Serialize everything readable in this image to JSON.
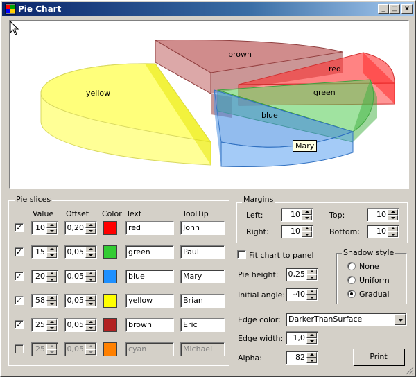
{
  "window": {
    "title": "Pie Chart",
    "minimize_label": "_",
    "maximize_label": "□",
    "close_label": "x"
  },
  "chart_data": {
    "type": "pie",
    "labels": [
      "red",
      "green",
      "blue",
      "yellow",
      "brown"
    ],
    "values": [
      10,
      15,
      20,
      58,
      25
    ],
    "offsets": [
      0.2,
      0.05,
      0.05,
      0.05,
      0.05
    ],
    "colors": [
      "#ff0000",
      "#33cc33",
      "#1e90ff",
      "#ffff00",
      "#b22222"
    ],
    "hidden_slice": {
      "label": "cyan",
      "value": 25
    }
  },
  "tooltip": {
    "text": "Mary"
  },
  "slices_panel": {
    "title": "Pie slices",
    "headers": {
      "value": "Value",
      "offset": "Offset",
      "color": "Color",
      "text": "Text",
      "tooltip": "ToolTip"
    },
    "rows": [
      {
        "checked": "✓",
        "value": "10",
        "offset": "0,20",
        "color": "#ff0000",
        "text": "red",
        "tooltip": "John",
        "enabled": true
      },
      {
        "checked": "✓",
        "value": "15",
        "offset": "0,05",
        "color": "#33cc33",
        "text": "green",
        "tooltip": "Paul",
        "enabled": true
      },
      {
        "checked": "✓",
        "value": "20",
        "offset": "0,05",
        "color": "#1e90ff",
        "text": "blue",
        "tooltip": "Mary",
        "enabled": true
      },
      {
        "checked": "✓",
        "value": "58",
        "offset": "0,05",
        "color": "#ffff00",
        "text": "yellow",
        "tooltip": "Brian",
        "enabled": true
      },
      {
        "checked": "✓",
        "value": "25",
        "offset": "0,05",
        "color": "#b22222",
        "text": "brown",
        "tooltip": "Eric",
        "enabled": true
      },
      {
        "checked": "",
        "value": "25",
        "offset": "0,05",
        "color": "#ff8000",
        "text": "cyan",
        "tooltip": "Michael",
        "enabled": false
      }
    ]
  },
  "margins": {
    "title": "Margins",
    "left_label": "Left:",
    "left_value": "10",
    "top_label": "Top:",
    "top_value": "10",
    "right_label": "Right:",
    "right_value": "10",
    "bottom_label": "Bottom:",
    "bottom_value": "10"
  },
  "fit_chart": {
    "label": "Fit chart to panel",
    "checked": ""
  },
  "pie_height": {
    "label": "Pie height:",
    "value": "0,25"
  },
  "initial_angle": {
    "label": "Initial angle:",
    "value": "-40"
  },
  "shadow_style": {
    "title": "Shadow style",
    "options": [
      "None",
      "Uniform",
      "Gradual"
    ],
    "selected": "Gradual"
  },
  "edge_color": {
    "label": "Edge color:",
    "value": "DarkerThanSurface"
  },
  "edge_width": {
    "label": "Edge width:",
    "value": "1,0"
  },
  "alpha": {
    "label": "Alpha:",
    "value": "82"
  },
  "print_button": {
    "label": "Print"
  }
}
